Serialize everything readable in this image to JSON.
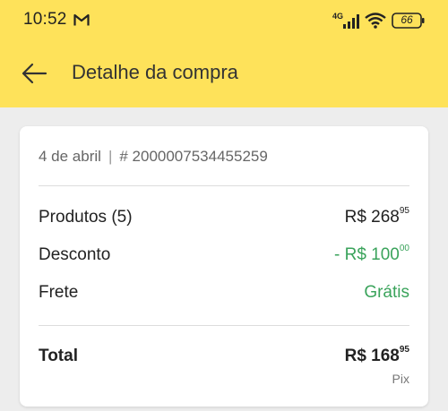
{
  "status_bar": {
    "time": "10:52",
    "network": "4G",
    "battery": "66"
  },
  "header": {
    "title": "Detalhe da compra"
  },
  "purchase": {
    "date": "4 de abril",
    "separator": "|",
    "order_number": "# 2000007534455259"
  },
  "summary": {
    "products": {
      "label": "Produtos (5)",
      "value": "R$ 268",
      "cents": "95"
    },
    "discount": {
      "label": "Desconto",
      "value": "- R$ 100",
      "cents": "00"
    },
    "shipping": {
      "label": "Frete",
      "value": "Grátis"
    },
    "total": {
      "label": "Total",
      "value": "R$ 168",
      "cents": "95",
      "payment_method": "Pix"
    }
  },
  "colors": {
    "header_bg": "#fee25a",
    "green": "#3aa35b"
  }
}
